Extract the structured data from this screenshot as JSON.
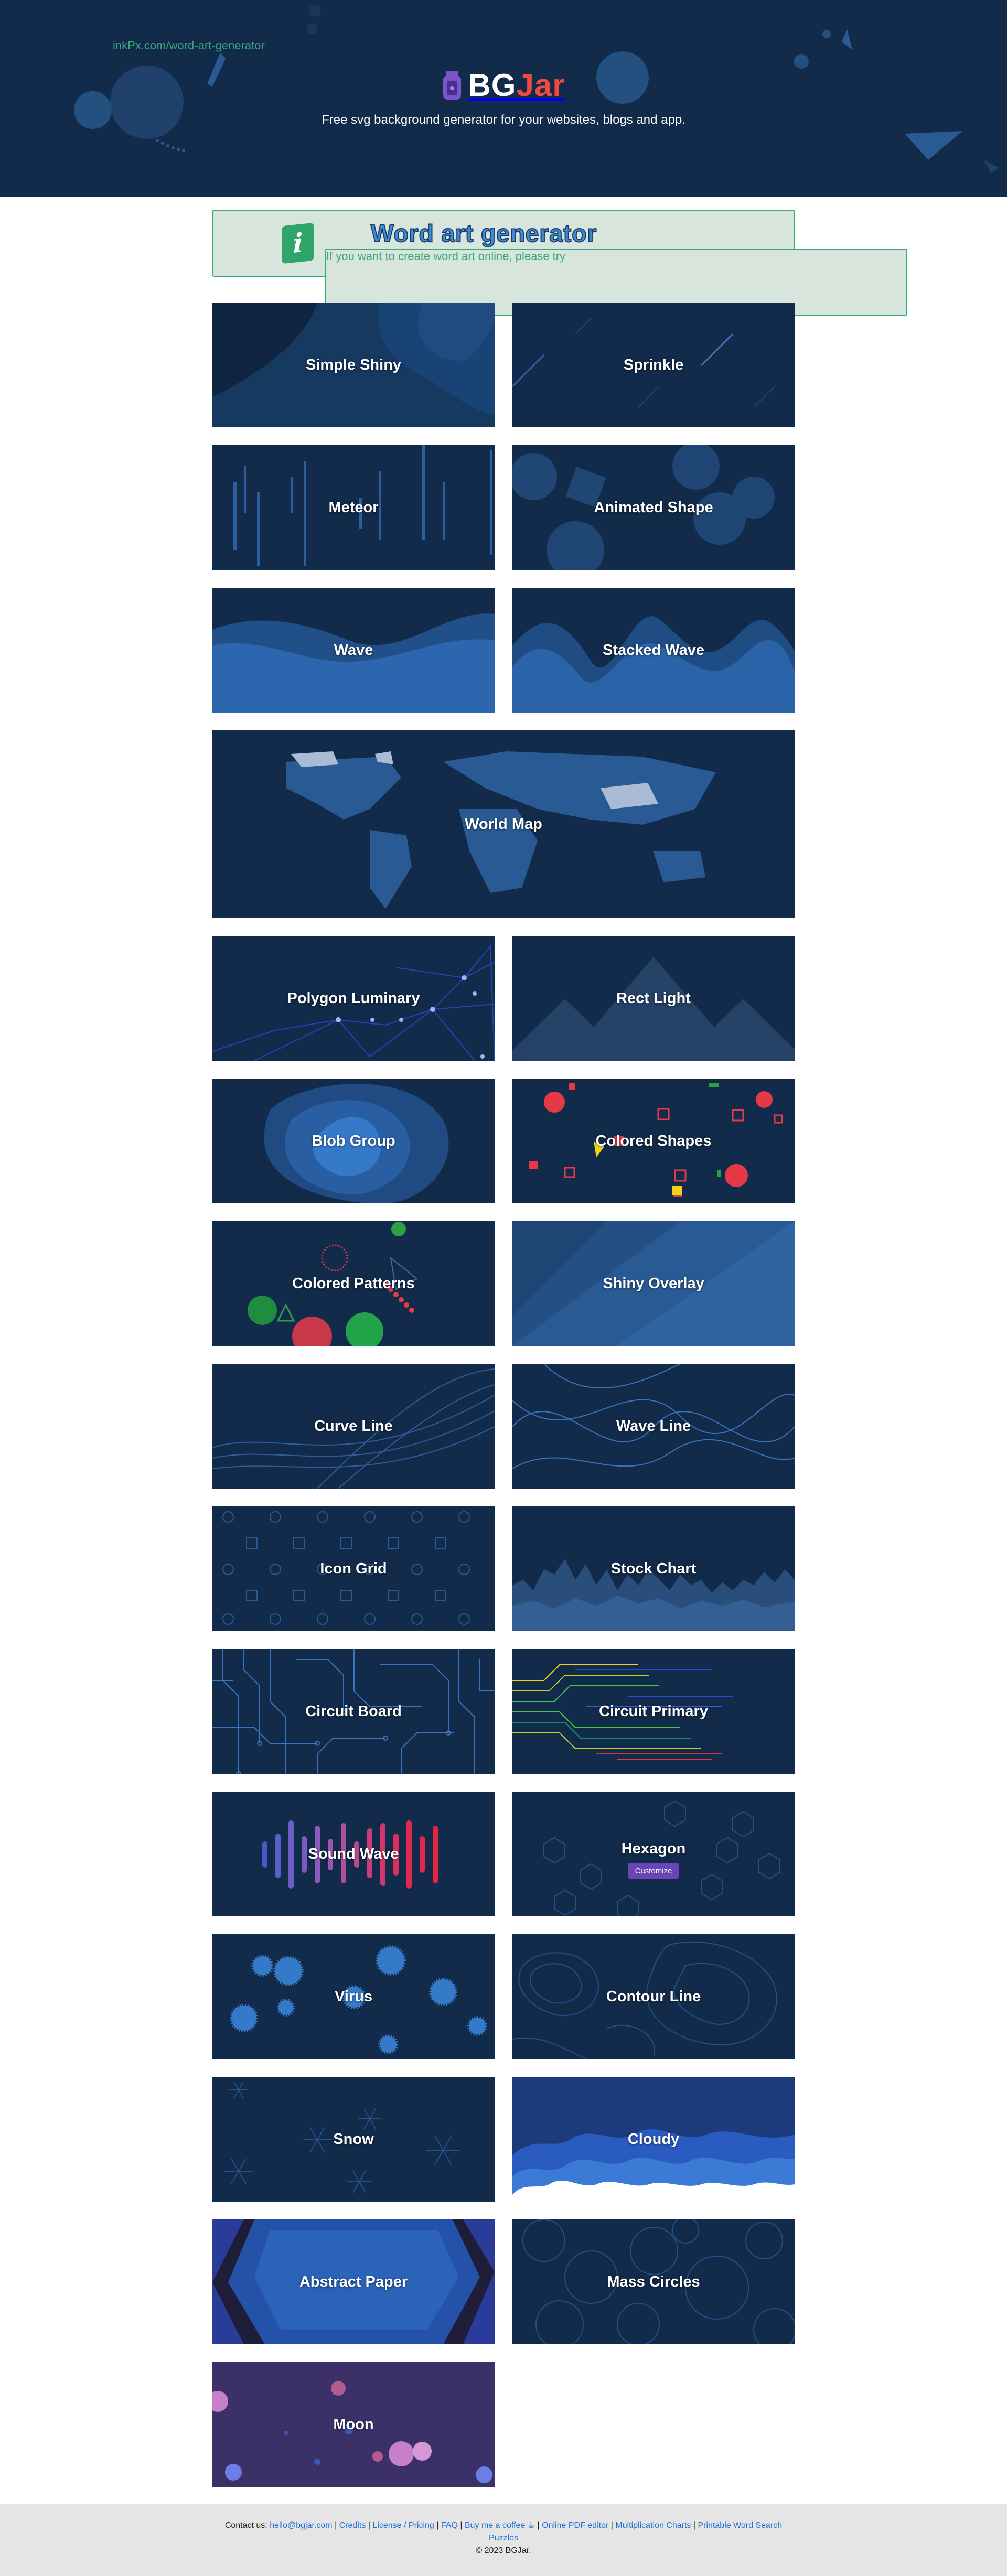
{
  "brand": {
    "logo_bg": "BG",
    "logo_jar": "Jar",
    "tagline": "Free svg background generator for your websites, blogs and app."
  },
  "promo": {
    "title": "Word art generator",
    "text_before": "If you want to create word art online, please try ",
    "link_text": "inkPx.com/word-art-generator",
    "icon": "info-icon"
  },
  "cards": [
    {
      "label": "Simple Shiny"
    },
    {
      "label": "Sprinkle"
    },
    {
      "label": "Meteor"
    },
    {
      "label": "Animated Shape"
    },
    {
      "label": "Wave"
    },
    {
      "label": "Stacked Wave"
    },
    {
      "label": "World Map"
    },
    {
      "label": "Polygon Luminary"
    },
    {
      "label": "Rect Light"
    },
    {
      "label": "Blob Group"
    },
    {
      "label": "Colored Shapes"
    },
    {
      "label": "Colored Patterns"
    },
    {
      "label": "Shiny Overlay"
    },
    {
      "label": "Curve Line"
    },
    {
      "label": "Wave Line"
    },
    {
      "label": "Icon Grid"
    },
    {
      "label": "Stock Chart"
    },
    {
      "label": "Circuit Board"
    },
    {
      "label": "Circuit Primary"
    },
    {
      "label": "Sound Wave"
    },
    {
      "label": "Hexagon",
      "button": "Customize"
    },
    {
      "label": "Virus"
    },
    {
      "label": "Contour Line"
    },
    {
      "label": "Snow"
    },
    {
      "label": "Cloudy"
    },
    {
      "label": "Abstract Paper"
    },
    {
      "label": "Mass Circles"
    },
    {
      "label": "Moon"
    }
  ],
  "footer": {
    "contact_prefix": "Contact us: ",
    "email": "hello@bgjar.com",
    "links": [
      "Credits",
      "License / Pricing",
      "FAQ",
      "Buy me a coffee ☕",
      "Online PDF editor",
      "Multiplication Charts",
      "Printable Word Search"
    ],
    "puzzles": "Puzzles",
    "copyright": "© 2023 BGJar."
  },
  "colors": {
    "hero_bg": "#132b4a",
    "card_bg": "#132b4a",
    "accent_red": "#f04a3f",
    "link_green": "#3aa77a",
    "link_blue": "#1a6fd8",
    "footer_bg": "#e5e5e5",
    "button_purple": "#6a45b8"
  }
}
